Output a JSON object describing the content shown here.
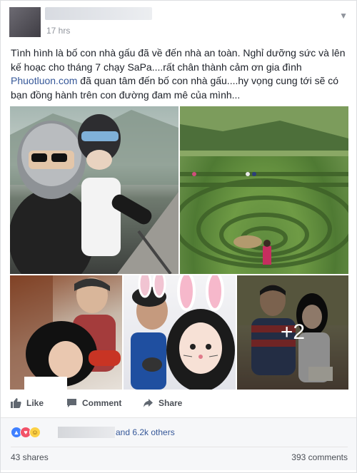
{
  "header": {
    "time": "17 hrs"
  },
  "post": {
    "text_before_link": "Tình hình là bố con nhà gấu đã về đến nhà an toàn. Nghỉ dưỡng sức và lên kế hoạc cho tháng 7 chạy SaPa....rất chân thành cảm ơn gia đình ",
    "link_text": "Phuotluon.com",
    "text_after_link": " đã quan tâm đến bố con nhà gấu....hy vọng cung tới sẽ có bạn đồng hành trên con đường đam mê của mình..."
  },
  "photos": {
    "more_count": "+2"
  },
  "actions": {
    "like": "Like",
    "comment": "Comment",
    "share": "Share"
  },
  "reactions": {
    "icons": [
      "like-icon",
      "love-icon",
      "haha-icon"
    ],
    "others_text": "and 6.2k others"
  },
  "stats": {
    "shares": "43 shares",
    "comments": "393 comments"
  },
  "colors": {
    "link": "#365899",
    "like_blue": "#4080ff",
    "love_red": "#f25268",
    "haha_yellow": "#fcd145"
  }
}
